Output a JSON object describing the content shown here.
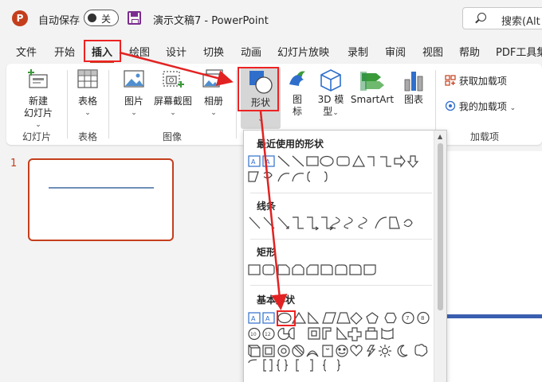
{
  "titlebar": {
    "logo_letter": "P",
    "autosave_label": "自动保存",
    "autosave_state": "关",
    "doc_title": "演示文稿7 - PowerPoint",
    "search_placeholder": "搜索(Alt"
  },
  "tabs": [
    {
      "label": "文件",
      "active": false
    },
    {
      "label": "开始",
      "active": false
    },
    {
      "label": "插入",
      "active": true
    },
    {
      "label": "绘图",
      "active": false
    },
    {
      "label": "设计",
      "active": false
    },
    {
      "label": "切换",
      "active": false
    },
    {
      "label": "动画",
      "active": false
    },
    {
      "label": "幻灯片放映",
      "active": false
    },
    {
      "label": "录制",
      "active": false
    },
    {
      "label": "审阅",
      "active": false
    },
    {
      "label": "视图",
      "active": false
    },
    {
      "label": "帮助",
      "active": false
    },
    {
      "label": "PDF工具集",
      "active": false
    }
  ],
  "ribbon": {
    "new_slide": {
      "line1": "新建",
      "line2": "幻灯片"
    },
    "table": "表格",
    "picture": "图片",
    "screenshot": "屏幕截图",
    "album": "相册",
    "shapes": "形状",
    "icons": {
      "line1": "图",
      "line2": "标"
    },
    "model3d": {
      "line1": "3D 模",
      "line2": "型"
    },
    "smartart": "SmartArt",
    "chart": "图表",
    "get_addins": "获取加载项",
    "my_addins": "我的加载项",
    "groups": {
      "slides": "幻灯片",
      "tables": "表格",
      "images": "图像",
      "addins": "加载项"
    }
  },
  "slide_panel": {
    "thumb_number": "1"
  },
  "shapes_menu": {
    "sections": {
      "recent": "最近使用的形状",
      "lines": "线条",
      "rectangles": "矩形",
      "basic": "基本形状"
    }
  },
  "colors": {
    "accent": "#c43e1c",
    "highlight": "#e22222",
    "slide_line": "#3b5fb0"
  }
}
